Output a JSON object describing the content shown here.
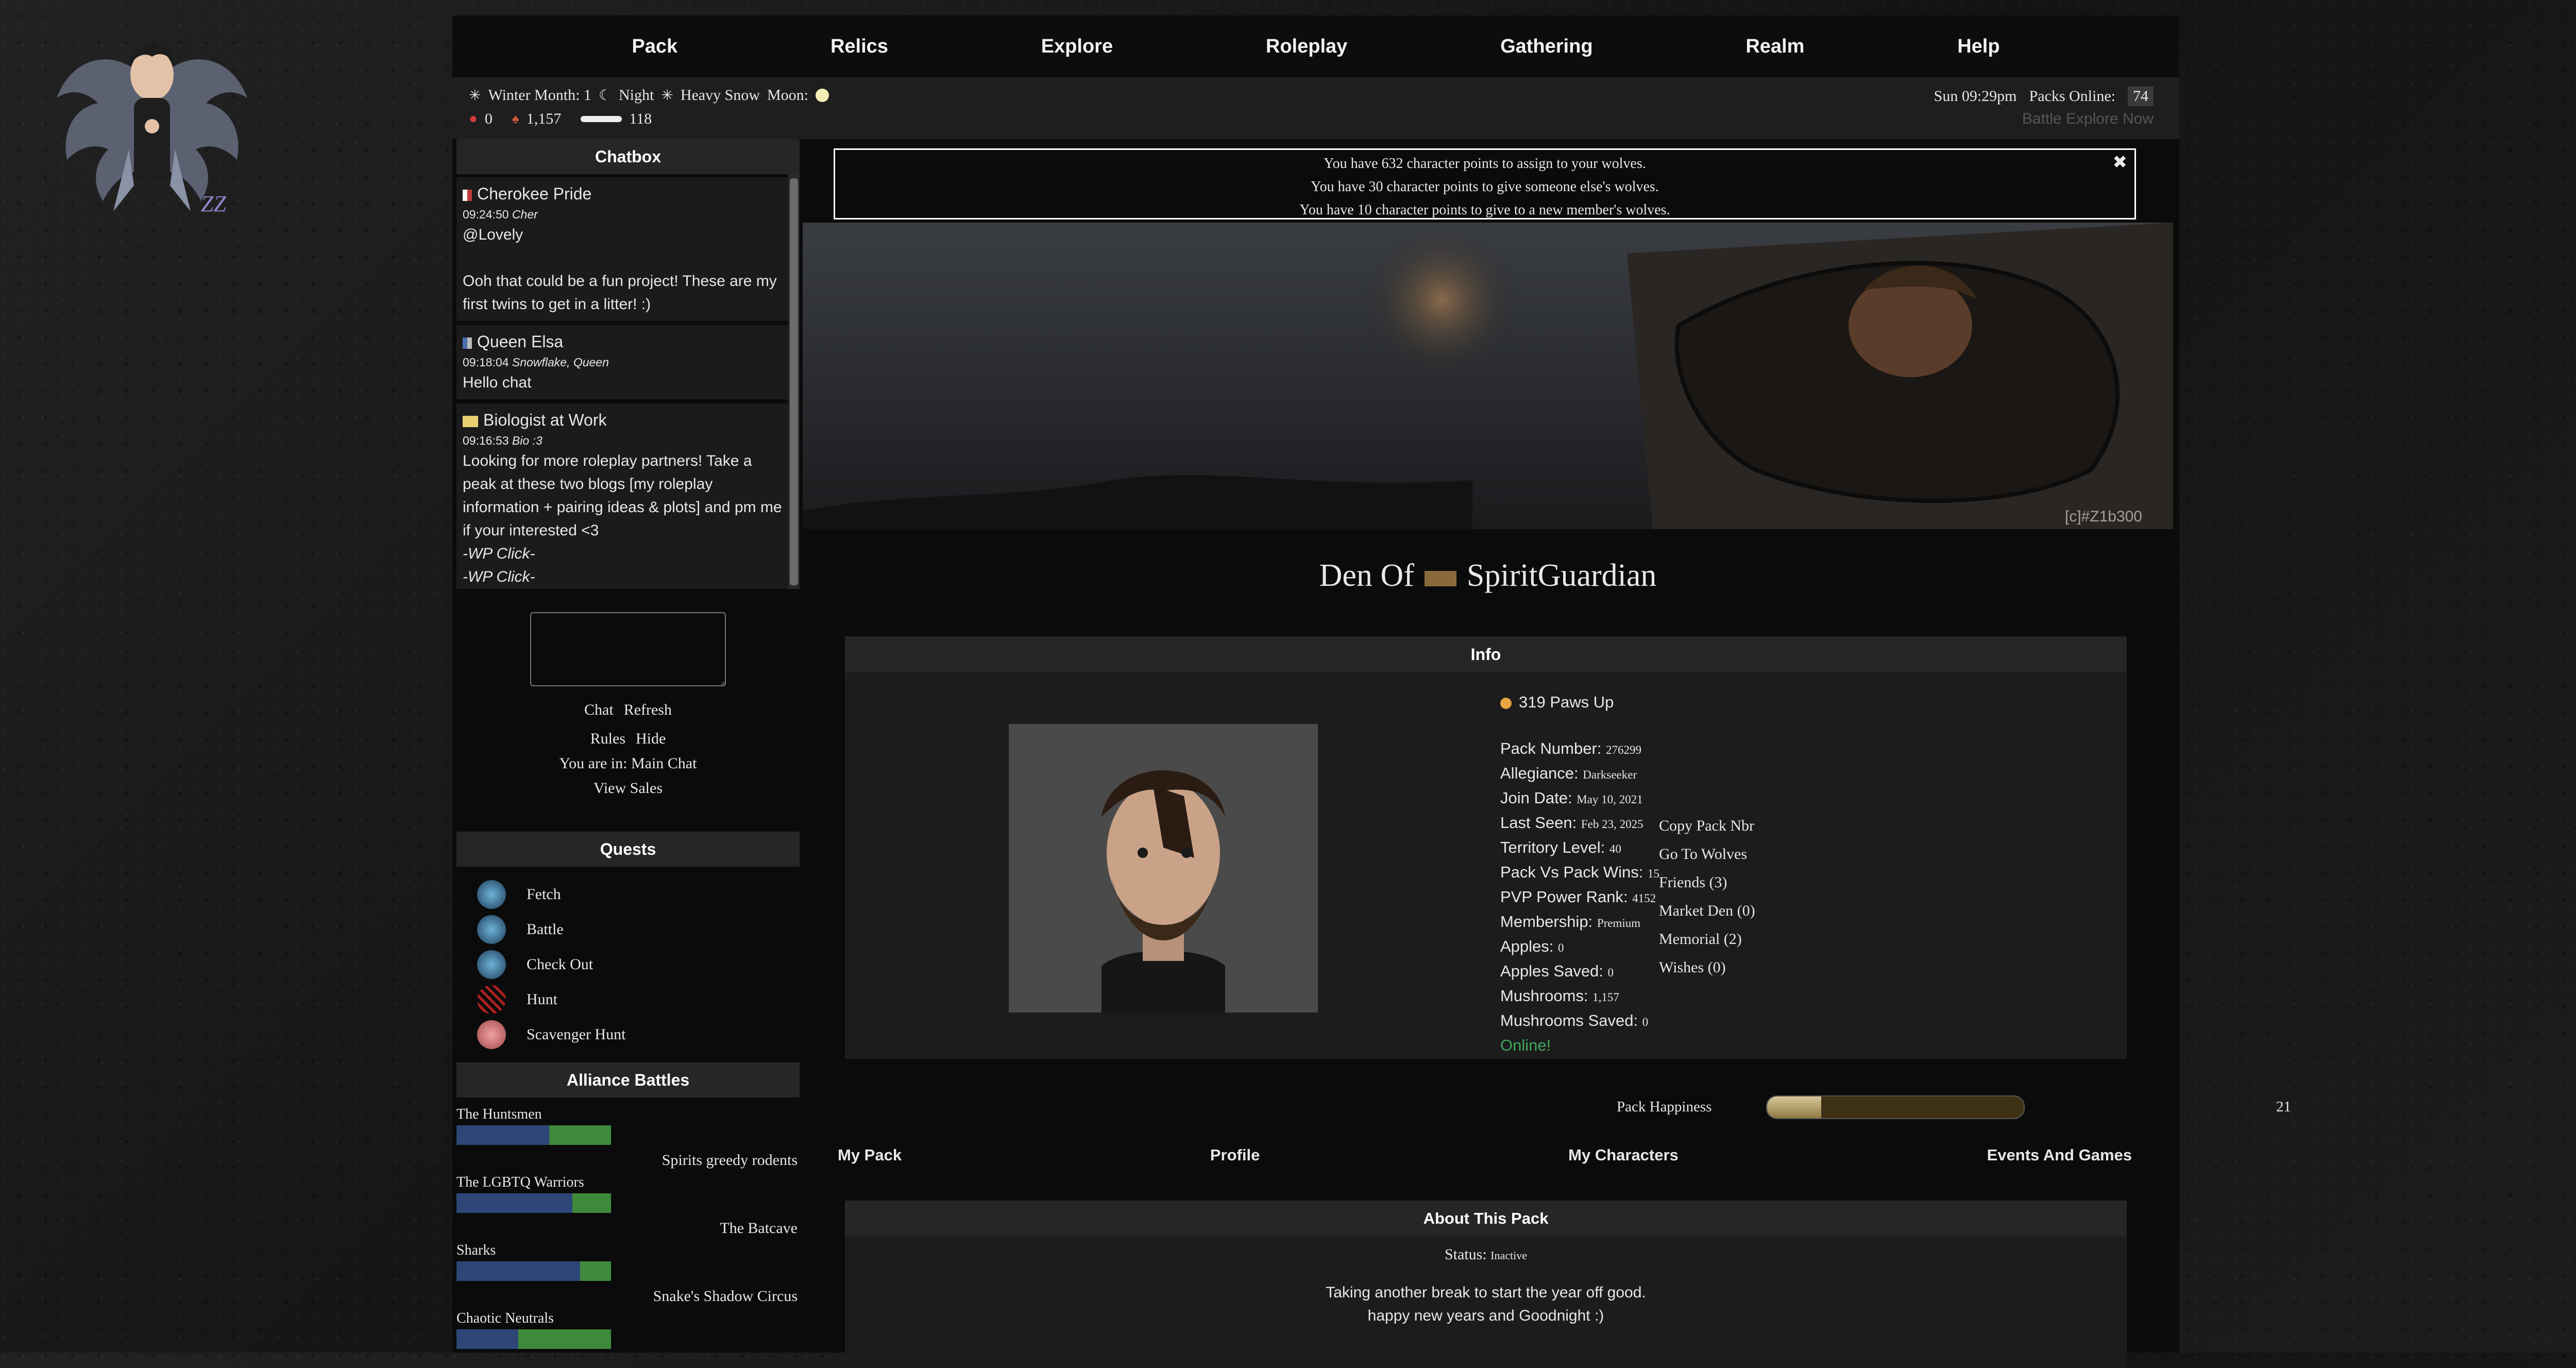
{
  "nav": {
    "items": [
      "Pack",
      "Relics",
      "Explore",
      "Roleplay",
      "Gathering",
      "Realm",
      "Help"
    ]
  },
  "status": {
    "season": "Winter Month: 1",
    "time_of_day": "Night",
    "weather": "Heavy Snow",
    "moon_label": "Moon:",
    "apples": "0",
    "mushrooms": "1,157",
    "bones": "118",
    "clock": "Sun 09:29pm",
    "packs_online_label": "Packs Online:",
    "packs_online": "74",
    "sub_right": "Battle  Explore  Now"
  },
  "chat": {
    "title": "Chatbox",
    "messages": [
      {
        "author": "Cherokee Pride",
        "time": "09:24:50",
        "nick": "Cher",
        "lines": [
          "@Lovely",
          "",
          "Ooh that could be a fun project! These are my first twins to get in a litter! :)"
        ],
        "flag": "#c23b3b"
      },
      {
        "author": "Queen Elsa",
        "time": "09:18:04",
        "nick": "Snowflake, Queen",
        "lines": [
          "Hello chat"
        ],
        "flag": "#4a6fb0"
      },
      {
        "author": "Biologist at Work",
        "time": "09:16:53",
        "nick": "Bio :3",
        "lines": [
          "Looking for more roleplay partners! Take a peak at these two blogs [my roleplay information + pairing ideas & plots] and pm me if your interested <3",
          "-WP Click-",
          "-WP Click-"
        ],
        "flag": "#e8d070"
      }
    ],
    "links": {
      "chat": "Chat",
      "refresh": "Refresh",
      "rules": "Rules",
      "hide": "Hide",
      "location": "You are in: Main Chat",
      "sales": "View Sales"
    }
  },
  "quests": {
    "title": "Quests",
    "items": [
      {
        "label": "Fetch",
        "icon": "claw-icon"
      },
      {
        "label": "Battle",
        "icon": "claw-icon"
      },
      {
        "label": "Check Out",
        "icon": "claw-icon"
      },
      {
        "label": "Hunt",
        "icon": "scratch-icon"
      },
      {
        "label": "Scavenger Hunt",
        "icon": "brain-icon"
      }
    ]
  },
  "alliance": {
    "title": "Alliance Battles",
    "battles": [
      {
        "team": "The Huntsmen",
        "opponent": "Spirits greedy rodents",
        "share": 0.6
      },
      {
        "team": "The LGBTQ Warriors",
        "opponent": "The Batcave",
        "share": 0.75
      },
      {
        "team": "Sharks",
        "opponent": "Snake's Shadow Circus",
        "share": 0.8
      },
      {
        "team": "Chaotic Neutrals",
        "opponent": "",
        "share": 0.4
      }
    ]
  },
  "notice": {
    "lines": [
      "You have 632 character points to assign to your wolves.",
      "You have 30 character points to give someone else's wolves.",
      "You have 10 character points to give to a new member's wolves."
    ]
  },
  "banner": {
    "credit": "[c]#Z1b300"
  },
  "den": {
    "prefix": "Den Of",
    "name": "SpiritGuardian"
  },
  "info": {
    "title": "Info",
    "paws": "319 Paws Up",
    "stats": [
      {
        "label": "Pack Number:",
        "value": "276299"
      },
      {
        "label": "Allegiance:",
        "value": "Darkseeker"
      },
      {
        "label": "Join Date:",
        "value": "May 10, 2021"
      },
      {
        "label": "Last Seen:",
        "value": "Feb 23, 2025"
      },
      {
        "label": "Territory Level:",
        "value": "40"
      },
      {
        "label": "Pack Vs Pack Wins:",
        "value": "15"
      },
      {
        "label": "PVP Power Rank:",
        "value": "4152"
      },
      {
        "label": "Membership:",
        "value": "Premium"
      },
      {
        "label": "Apples:",
        "value": "0"
      },
      {
        "label": "Apples Saved:",
        "value": "0"
      },
      {
        "label": "Mushrooms:",
        "value": "1,157"
      },
      {
        "label": "Mushrooms Saved:",
        "value": "0"
      }
    ],
    "online": "Online!",
    "links": [
      "Copy Pack Nbr",
      "Go To Wolves",
      "Friends (3)",
      "Market Den (0)",
      "Memorial (2)",
      "Wishes (0)"
    ]
  },
  "happiness": {
    "label": "Pack Happiness",
    "value": "21",
    "fraction": 0.21
  },
  "tabs": [
    "My Pack",
    "Profile",
    "My Characters",
    "Events And Games"
  ],
  "about": {
    "title": "About This Pack",
    "status_label": "Status:",
    "status_value": "Inactive",
    "text_lines": [
      "Taking another break to start the year off good.",
      "happy new years and Goodnight :)"
    ]
  }
}
